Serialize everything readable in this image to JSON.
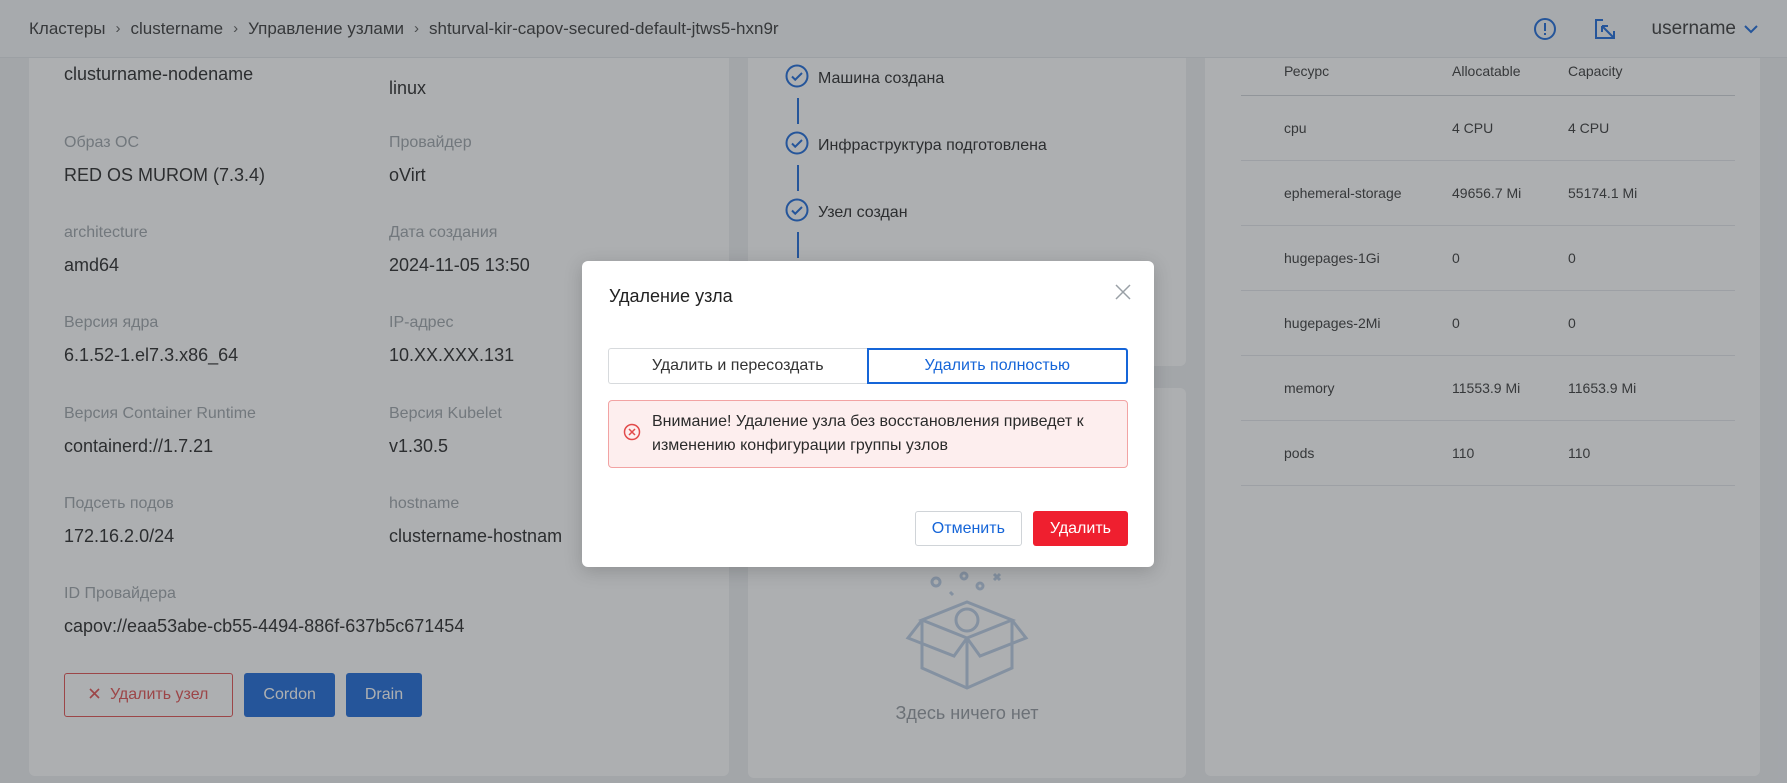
{
  "header": {
    "breadcrumbs": [
      "Кластеры",
      "clustername",
      "Управление узлами",
      "shturval-kir-capov-secured-default-jtws5-hxn9r"
    ],
    "username": "username",
    "icons": [
      "alert-circle-icon",
      "open-external-icon",
      "chevron-down-icon"
    ]
  },
  "node_info": {
    "name_value": "clusturname-nodename",
    "os_type_value": "linux",
    "fields": [
      {
        "label": "Образ ОС",
        "value": "RED OS MUROM (7.3.4)"
      },
      {
        "label": "Провайдер",
        "value": "oVirt"
      },
      {
        "label": "architecture",
        "value": "amd64"
      },
      {
        "label": "Дата создания",
        "value": "2024-11-05 13:50"
      },
      {
        "label": "Версия ядра",
        "value": "6.1.52-1.el7.3.x86_64"
      },
      {
        "label": "IP-адрес",
        "value": "10.XX.XXX.131"
      },
      {
        "label": "Версия Container Runtime",
        "value": "containerd://1.7.21"
      },
      {
        "label": "Версия Kubelet",
        "value": "v1.30.5"
      },
      {
        "label": "Подсеть подов",
        "value": "172.16.2.0/24"
      },
      {
        "label": "hostname",
        "value": "clustername-hostnam"
      },
      {
        "label": "ID Провайдера",
        "value": "capov://eaa53abe-cb55-4494-886f-637b5c671454"
      }
    ],
    "actions": {
      "delete_node": "Удалить узел",
      "cordon": "Cordon",
      "drain": "Drain"
    }
  },
  "status_steps": [
    "Машина создана",
    "Инфраструктура подготовлена",
    "Узел создан"
  ],
  "empty_state": {
    "text": "Здесь ничего нет"
  },
  "resources": {
    "headers": [
      "Ресурс",
      "Allocatable",
      "Capacity"
    ],
    "rows": [
      [
        "cpu",
        "4 CPU",
        "4 CPU"
      ],
      [
        "ephemeral-storage",
        "49656.7 Mi",
        "55174.1 Mi"
      ],
      [
        "hugepages-1Gi",
        "0",
        "0"
      ],
      [
        "hugepages-2Mi",
        "0",
        "0"
      ],
      [
        "memory",
        "11553.9 Mi",
        "11653.9 Mi"
      ],
      [
        "pods",
        "110",
        "110"
      ]
    ]
  },
  "modal": {
    "title": "Удаление узла",
    "options": [
      "Удалить и пересоздать",
      "Удалить полностью"
    ],
    "selected_option": "Удалить полностью",
    "warning": "Внимание! Удаление узла без восстановления приведет к изменению конфигурации группы узлов",
    "cancel": "Отменить",
    "confirm": "Удалить"
  },
  "colors": {
    "primary": "#1565d8",
    "danger": "#ef1f2f",
    "alert_bg": "#fdeeee",
    "overlay": "rgba(60,64,70,0.42)"
  }
}
